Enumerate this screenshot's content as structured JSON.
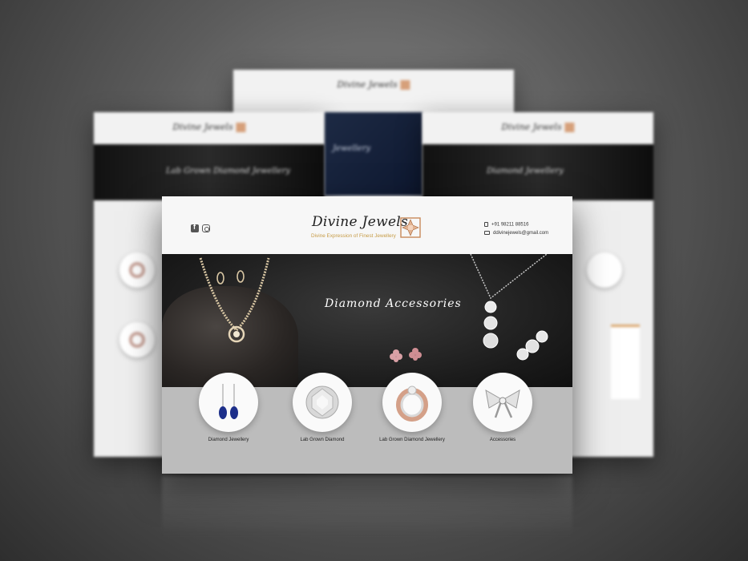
{
  "brand": {
    "name": "Divine Jewels",
    "tagline": "Divine Expression of Finest Jewellery",
    "accent_color": "#c69b45"
  },
  "header": {
    "social_icons": [
      "facebook-icon",
      "instagram-icon"
    ],
    "phone": "+91 98211 88516",
    "email": "ddivinejewels@gmail.com"
  },
  "banner": {
    "title": "Diamond Accessories"
  },
  "categories": [
    {
      "label": "Diamond Jewellery",
      "icon": "earrings-icon"
    },
    {
      "label": "Lab Grown Diamond",
      "icon": "diamond-icon"
    },
    {
      "label": "Lab Grown Diamond Jewellery",
      "icon": "ring-icon"
    },
    {
      "label": "Accessories",
      "icon": "bow-brooch-icon"
    }
  ],
  "background_mockups": {
    "left_banner_text": "Lab Grown Diamond Jewellery",
    "center_banner_text": "Jewellery",
    "right_banner_text": "Diamond Jewellery"
  }
}
